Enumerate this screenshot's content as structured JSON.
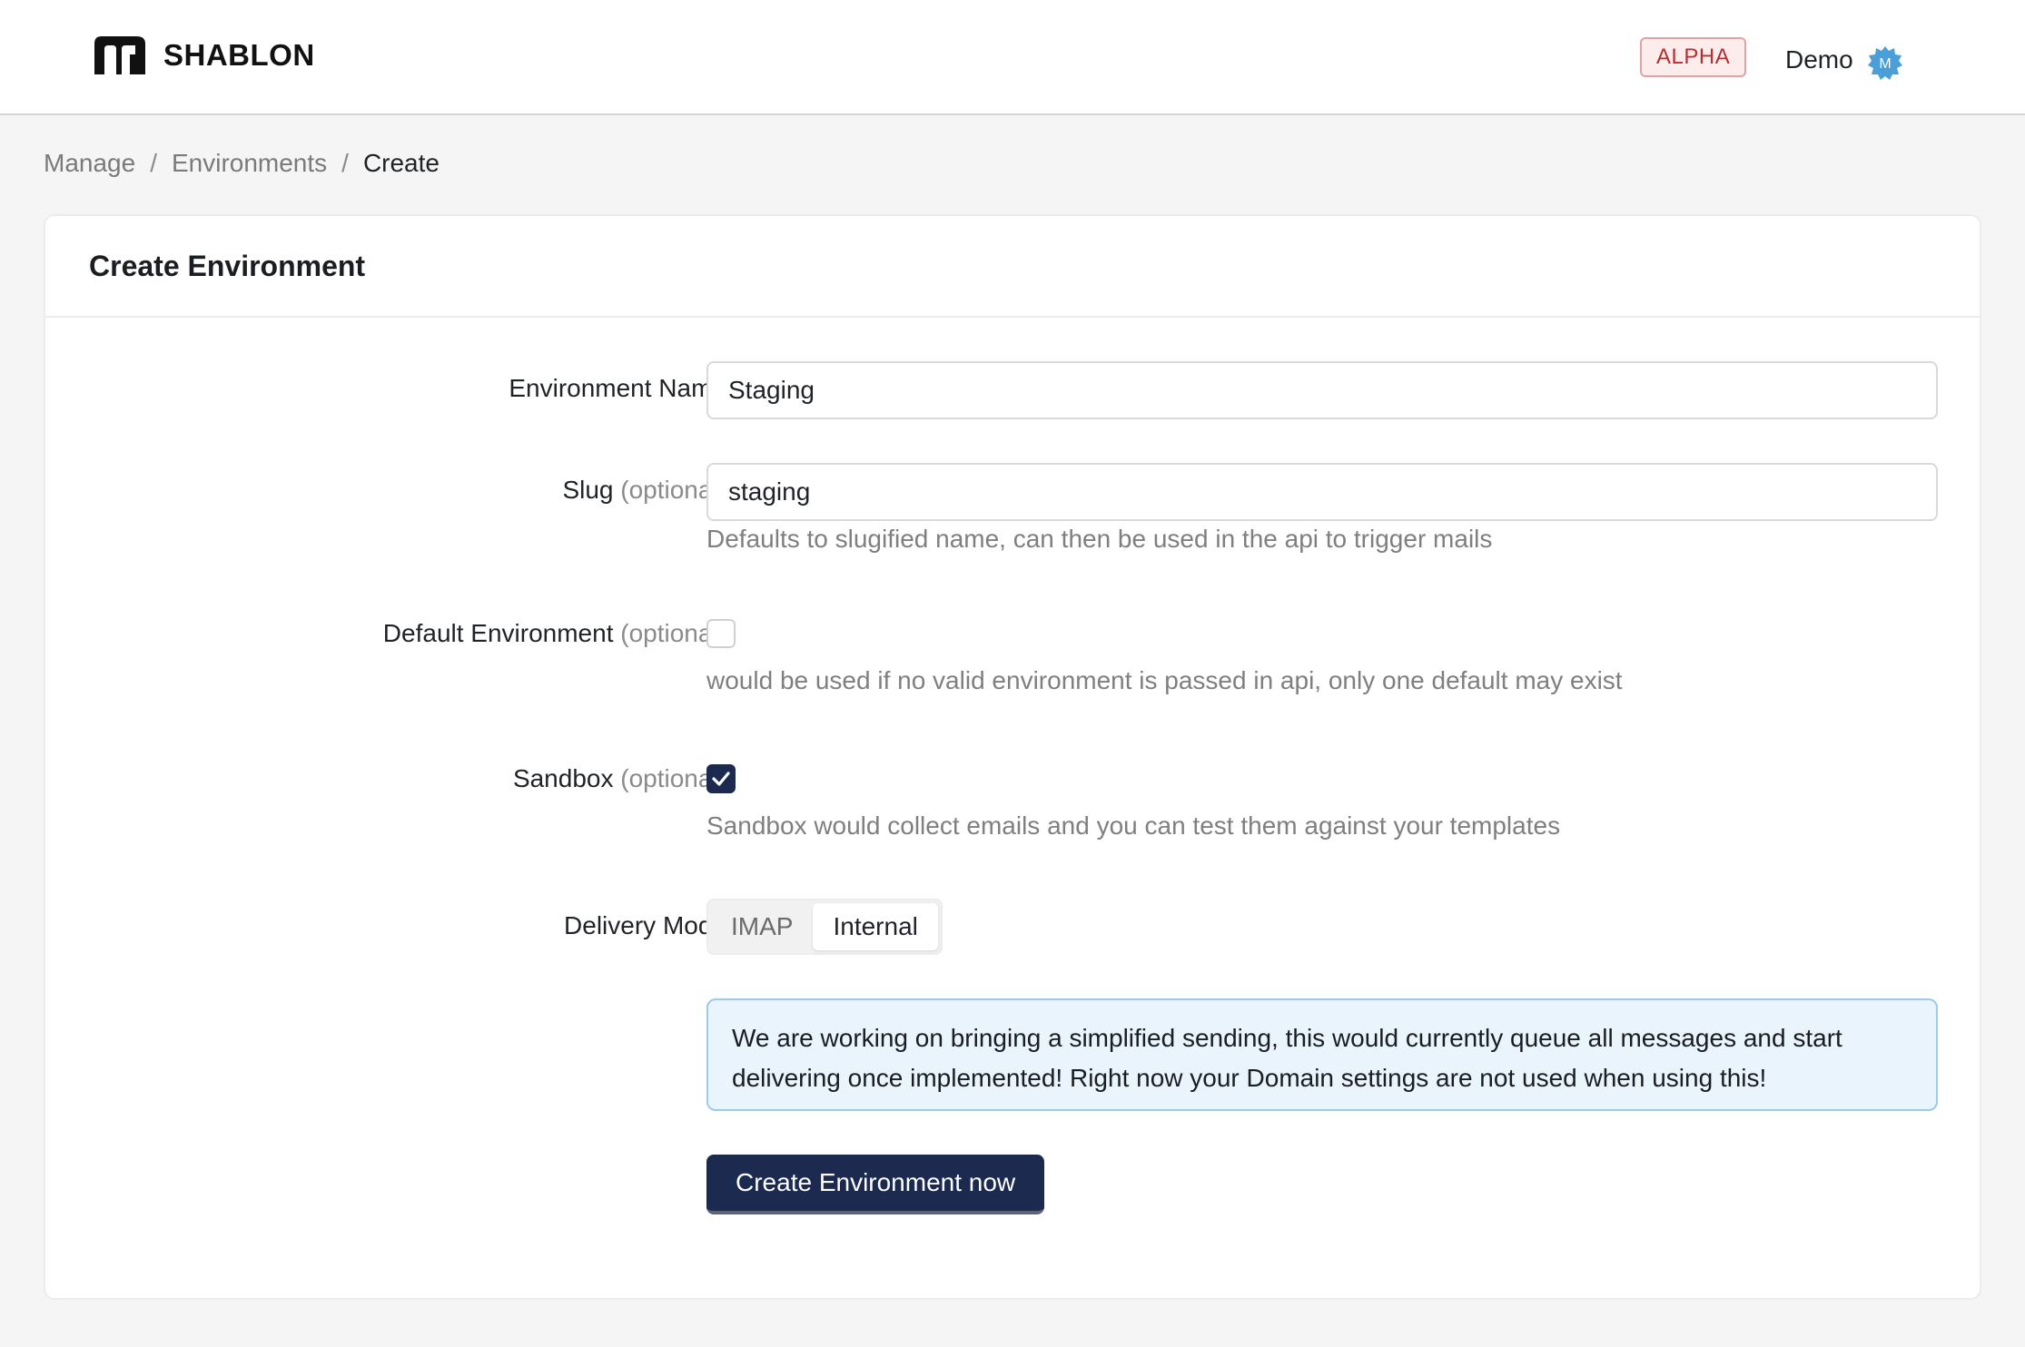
{
  "header": {
    "brand_name": "SHABLON",
    "badge": "ALPHA",
    "user_name": "Demo",
    "avatar_letter": "M"
  },
  "breadcrumb": [
    "Manage",
    "Environments",
    "Create"
  ],
  "form": {
    "title": "Create Environment",
    "name_label": "Environment Name",
    "name_value": "Staging",
    "slug_label": "Slug",
    "slug_optional": "(optional)",
    "slug_value": "staging",
    "slug_hint": "Defaults to slugified name, can then be used in the api to trigger mails",
    "default_label": "Default Environment",
    "default_optional": "(optional)",
    "default_checked": false,
    "default_hint": "would be used if no valid environment is passed in api, only one default may exist",
    "sandbox_label": "Sandbox",
    "sandbox_optional": "(optional)",
    "sandbox_checked": true,
    "sandbox_hint": "Sandbox would collect emails and you can test them against your templates",
    "delivery_label": "Delivery Mode",
    "delivery_options": [
      "IMAP",
      "Internal"
    ],
    "delivery_selected": "Internal",
    "notice": "We are working on bringing a simplified sending, this would currently queue all messages and start delivering once implemented! Right now your Domain settings are not used when using this!",
    "submit_label": "Create Environment now"
  },
  "colors": {
    "primary": "#1b2a4e",
    "badge_text": "#b43030",
    "notice_bg": "#eaf4fc",
    "notice_border": "#9ccaea",
    "avatar": "#4a9fd8"
  }
}
